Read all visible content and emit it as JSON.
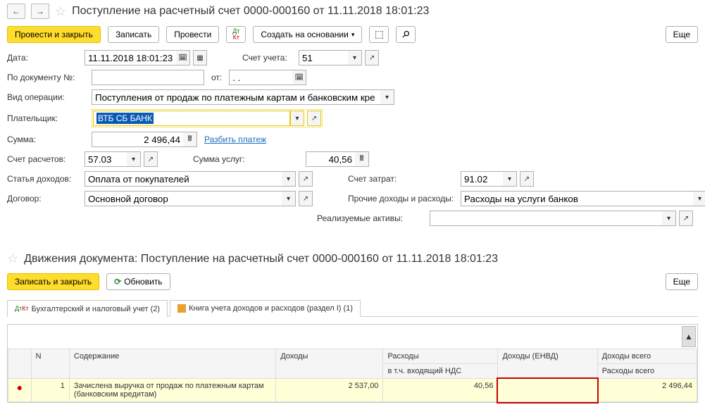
{
  "header": {
    "title": "Поступление на расчетный счет 0000-000160 от 11.11.2018 18:01:23"
  },
  "toolbar1": {
    "apply_close": "Провести и закрыть",
    "save": "Записать",
    "apply": "Провести",
    "create_base": "Создать на основании",
    "more": "Еще"
  },
  "form": {
    "date_label": "Дата:",
    "date_value": "11.11.2018 18:01:23",
    "account_label": "Счет учета:",
    "account_value": "51",
    "docnum_label": "По документу №:",
    "docnum_value": "",
    "from_label": "от:",
    "from_value": ". .",
    "optype_label": "Вид операции:",
    "optype_value": "Поступления от продаж по платежным картам и банковским кре",
    "payer_label": "Плательщик:",
    "payer_value": "ВТБ СБ БАНК",
    "sum_label": "Сумма:",
    "sum_value": "2 496,44",
    "split_link": "Разбить платеж",
    "settle_label": "Счет расчетов:",
    "settle_value": "57.03",
    "svc_sum_label": "Сумма услуг:",
    "svc_sum_value": "40,56",
    "income_label": "Статья доходов:",
    "income_value": "Оплата от покупателей",
    "expense_acc_label": "Счет затрат:",
    "expense_acc_value": "91.02",
    "contract_label": "Договор:",
    "contract_value": "Основной договор",
    "other_label": "Прочие доходы и расходы:",
    "other_value": "Расходы на услуги банков",
    "assets_label": "Реализуемые активы:",
    "assets_value": ""
  },
  "section2": {
    "title": "Движения документа: Поступление на расчетный счет 0000-000160 от 11.11.2018 18:01:23",
    "save_close": "Записать и закрыть",
    "refresh": "Обновить",
    "more": "Еще",
    "tab1": "Бухгалтерский и налоговый учет (2)",
    "tab2": "Книга учета доходов и расходов (раздел I) (1)"
  },
  "table": {
    "h_n": "N",
    "h_content": "Содержание",
    "h_income": "Доходы",
    "h_expense": "Расходы",
    "h_income_envd": "Доходы (ЕНВД)",
    "h_income_total": "Доходы всего",
    "h_vat": "в т.ч. входящий НДС",
    "h_expense_total": "Расходы всего",
    "row1": {
      "n": "1",
      "content": "Зачислена выручка от продаж по платежным картам (банковским кредитам)",
      "income": "2 537,00",
      "expense": "40,56",
      "income_envd": "",
      "income_total": "2 496,44"
    }
  }
}
